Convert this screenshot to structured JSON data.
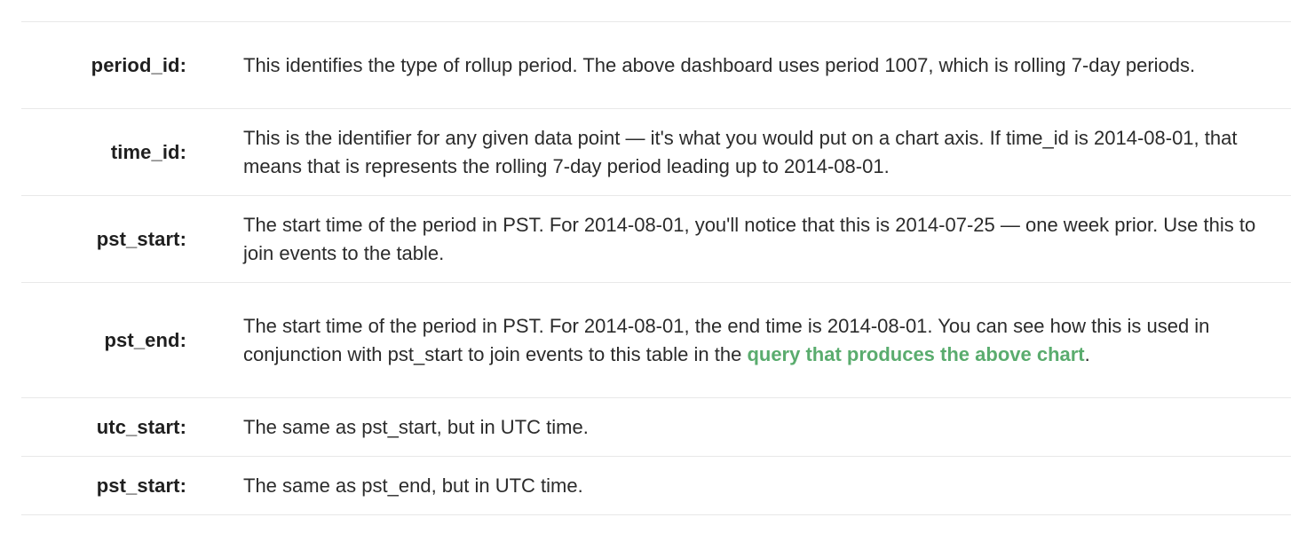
{
  "rows": [
    {
      "term": "period_id:",
      "description": "This identifies the type of rollup period. The above dashboard uses period 1007, which is rolling 7-day periods."
    },
    {
      "term": "time_id:",
      "description": "This is the identifier for any given data point — it's what you would put on a chart axis. If time_id is 2014-08-01, that means that is represents the rolling 7-day period leading up to 2014-08-01."
    },
    {
      "term": "pst_start:",
      "description": "The start time of the period in PST. For 2014-08-01, you'll notice that this is 2014-07-25 — one week prior. Use this to join events to the table."
    },
    {
      "term": "pst_end:",
      "description_before_link": "The start time of the period in PST. For 2014-08-01, the end time is 2014-08-01. You can see how this is used in conjunction with pst_start to join events to this table in the ",
      "link_text": "query that produces the above chart",
      "description_after_link": "."
    },
    {
      "term": "utc_start:",
      "description": "The same as pst_start, but in UTC time."
    },
    {
      "term": "pst_start:",
      "description": "The same as pst_end, but in UTC time."
    }
  ],
  "colors": {
    "link": "#5aac6e",
    "divider": "#e8e8e8",
    "text": "#2b2b2b"
  }
}
